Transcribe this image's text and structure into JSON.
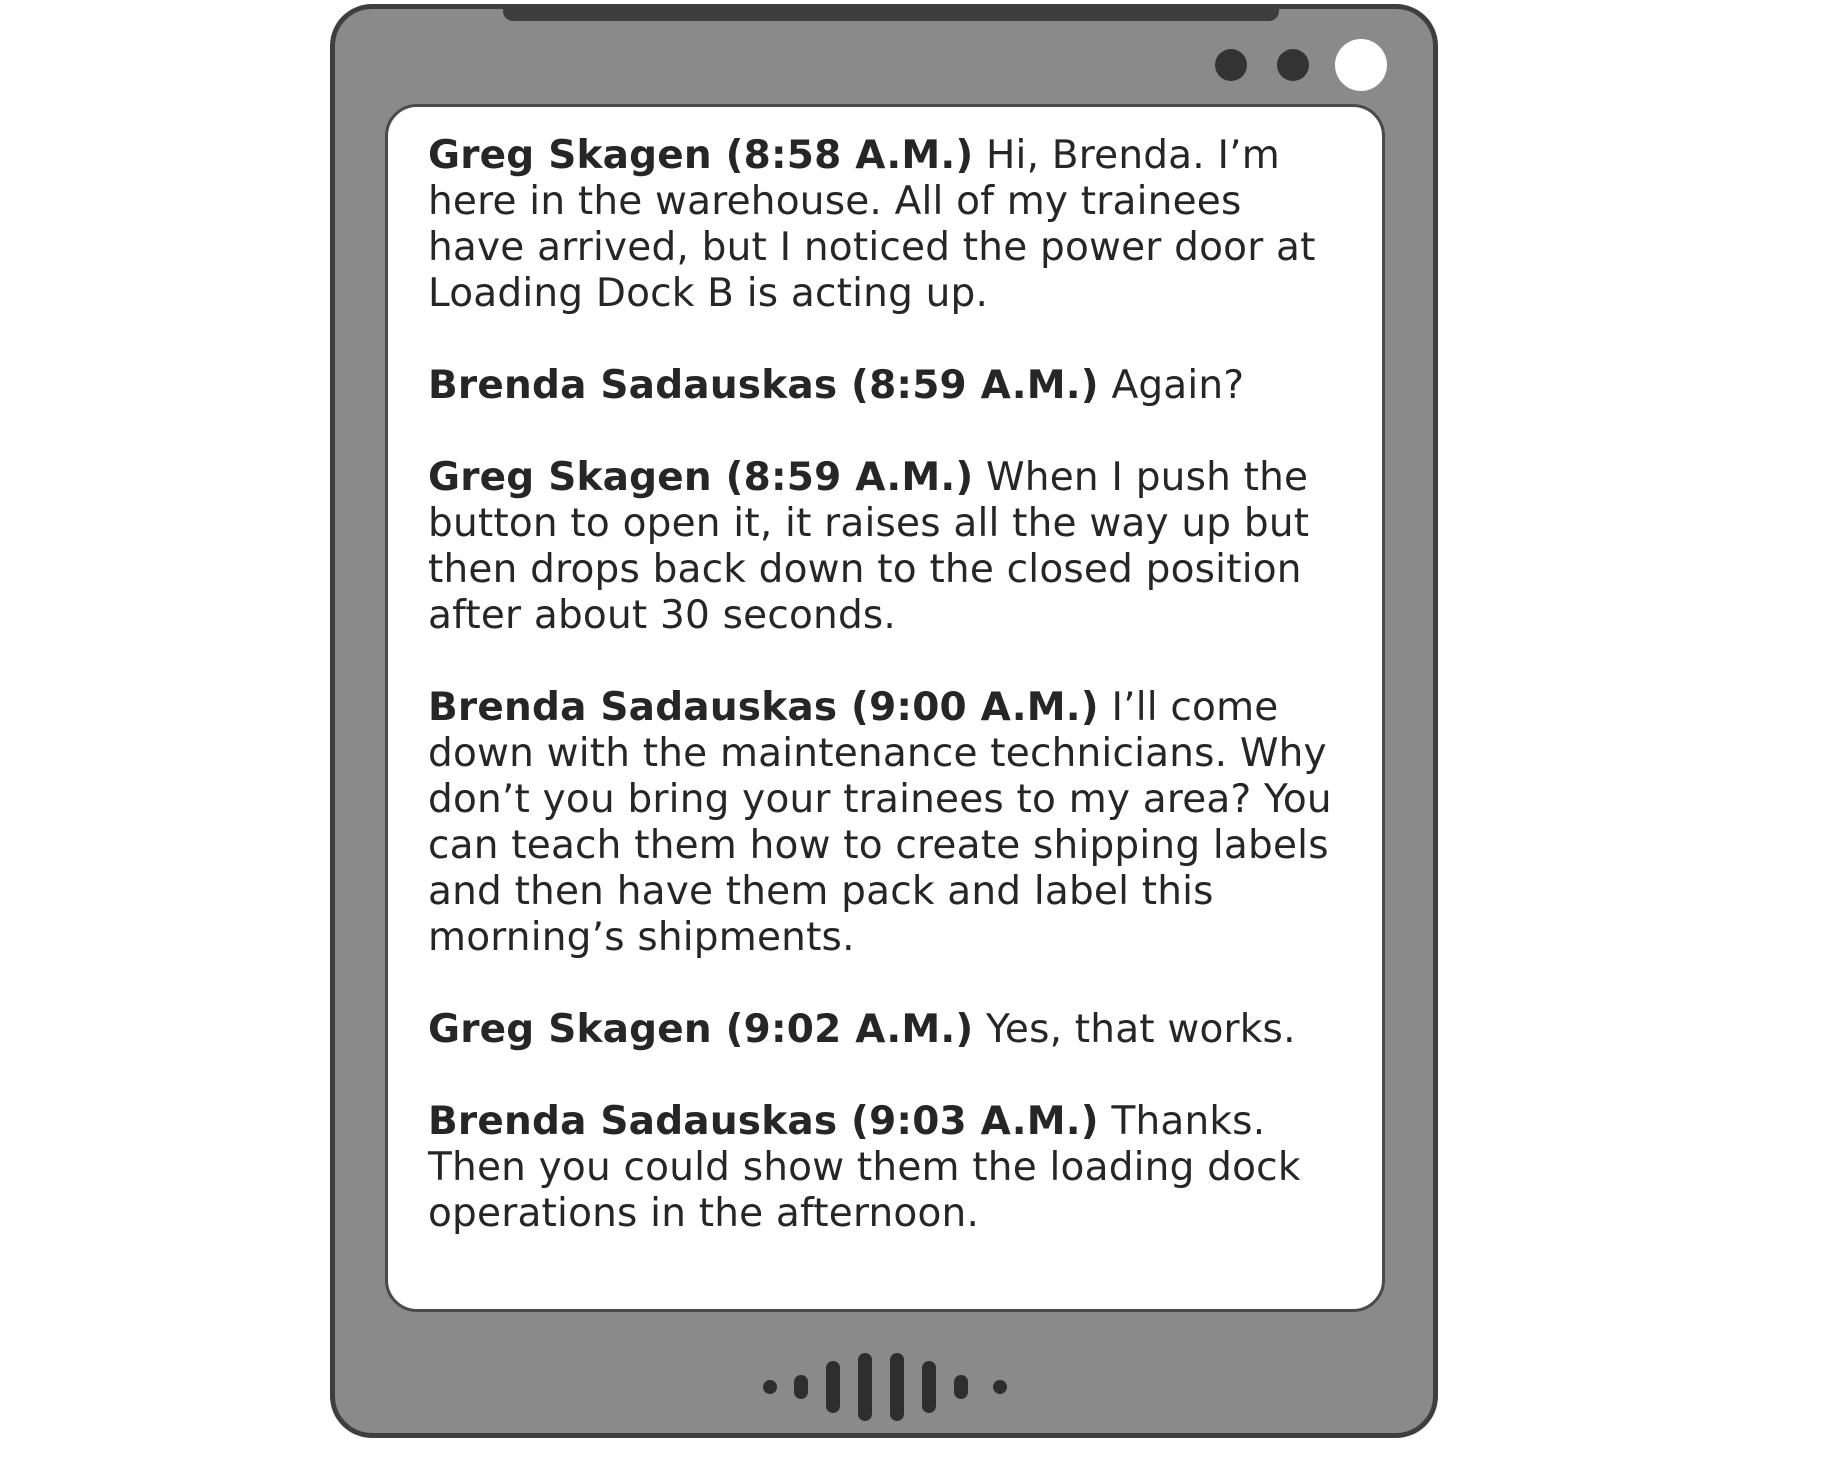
{
  "messages": [
    {
      "sender": "Greg Skagen (8:58 A.M.)",
      "text": "Hi, Brenda. I’m here in the warehouse. All of my trainees have arrived, but I noticed the power door at Loading Dock B is acting up."
    },
    {
      "sender": "Brenda Sadauskas (8:59 A.M.)",
      "text": "Again?"
    },
    {
      "sender": "Greg Skagen (8:59 A.M.)",
      "text": "When I push the button to open it, it raises all the way up but then drops back down to the closed position after about 30 seconds."
    },
    {
      "sender": "Brenda Sadauskas (9:00 A.M.)",
      "text": "I’ll come down with the maintenance technicians. Why don’t you bring your trainees to my area? You can teach them how to create shipping labels and then have them pack and label this morning’s shipments."
    },
    {
      "sender": "Greg Skagen (9:02 A.M.)",
      "text": "Yes, that works."
    },
    {
      "sender": "Brenda Sadauskas (9:03 A.M.)",
      "text": "Thanks. Then you could show them the loading dock operations in the afternoon."
    }
  ],
  "colors": {
    "device_body": "#8a8a8a",
    "device_border": "#3e3e3e",
    "screen": "#ffffff",
    "text": "#262626"
  },
  "icons": [
    "camera-dot-icon",
    "camera-dot-icon",
    "camera-lens-icon",
    "speaker-grille-icon"
  ]
}
